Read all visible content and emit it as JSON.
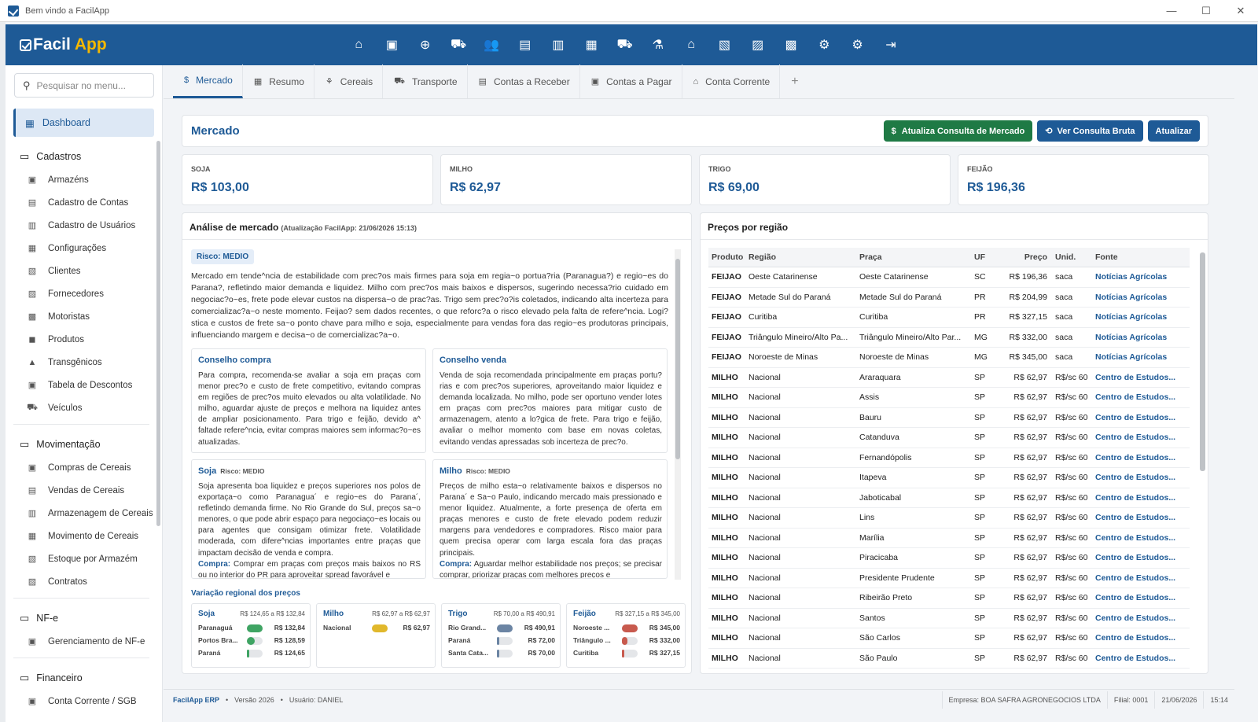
{
  "window": {
    "title": "Bem vindo a FacilApp",
    "controls": [
      "—",
      "☐",
      "✕"
    ]
  },
  "header": {
    "logo_a": "Facil",
    "logo_b": "App",
    "icons": [
      "home-icon",
      "wallet-icon",
      "cart-plus-icon",
      "cart-icon",
      "users-icon",
      "receipt-icon",
      "clipboard-icon",
      "id-badge-icon",
      "truck-icon",
      "flask-icon",
      "bank-icon",
      "money-check-icon",
      "cash-register-icon",
      "invoice-dollar-icon",
      "user-gear-icon",
      "settings-icon",
      "logout-icon"
    ],
    "glyphs": [
      "⌂",
      "▣",
      "⊕",
      "⛟",
      "👥",
      "▤",
      "▥",
      "▦",
      "⛟",
      "⚗",
      "⌂",
      "▧",
      "▨",
      "▩",
      "⚙",
      "⚙",
      "⇥"
    ]
  },
  "sidebar": {
    "search_placeholder": "Pesquisar no menu...",
    "dashboard": "Dashboard",
    "sections": [
      {
        "title": "Cadastros",
        "items": [
          "Armazéns",
          "Cadastro de Contas",
          "Cadastro de Usuários",
          "Configurações",
          "Clientes",
          "Fornecedores",
          "Motoristas",
          "Produtos",
          "Transgênicos",
          "Tabela de Descontos",
          "Veículos"
        ]
      },
      {
        "title": "Movimentação",
        "items": [
          "Compras de Cereais",
          "Vendas de Cereais",
          "Armazenagem de Cereais",
          "Movimento de Cereais",
          "Estoque por Armazém",
          "Contratos"
        ]
      },
      {
        "title": "NF-e",
        "items": [
          "Gerenciamento de NF-e"
        ]
      },
      {
        "title": "Financeiro",
        "items": [
          "Conta Corrente / SGB"
        ]
      }
    ]
  },
  "tabs": [
    {
      "label": "Mercado",
      "icon": "$"
    },
    {
      "label": "Resumo",
      "icon": "▦"
    },
    {
      "label": "Cereais",
      "icon": "⚘"
    },
    {
      "label": "Transporte",
      "icon": "⛟"
    },
    {
      "label": "Contas a Receber",
      "icon": "▤"
    },
    {
      "label": "Contas a Pagar",
      "icon": "▣"
    },
    {
      "label": "Conta Corrente",
      "icon": "⌂"
    }
  ],
  "tab_add": "+",
  "mercado": {
    "title": "Mercado",
    "btn_atualiza": "Atualiza Consulta de Mercado",
    "btn_bruta": "Ver Consulta Bruta",
    "btn_atualizar": "Atualizar"
  },
  "prices": [
    {
      "label": "SOJA",
      "value": "R$ 103,00"
    },
    {
      "label": "MILHO",
      "value": "R$ 62,97"
    },
    {
      "label": "TRIGO",
      "value": "R$ 69,00"
    },
    {
      "label": "FEIJÃO",
      "value": "R$ 196,36"
    }
  ],
  "analise": {
    "title": "Análise de mercado",
    "update": "(Atualização FacilApp: 21/06/2026 15:13)",
    "risk": "Risco: MEDIO",
    "text": "Mercado em tende^ncia de estabilidade com prec?os mais firmes para soja em regia~o portua?ria (Paranagua?) e regio~es do Parana?, refletindo maior demanda e liquidez. Milho com prec?os mais baixos e dispersos, sugerindo necessa?rio cuidado em negociac?o~es, frete pode elevar custos na dispersa~o de prac?as. Trigo sem prec?o?is coletados, indicando alta incerteza para comercializac?a~o neste momento. Feijao? sem dados recentes, o que reforc?a o risco elevado pela falta de refere^ncia. Logi?stica e custos de frete sa~o ponto chave para milho e soja, especialmente para vendas fora das regio~es produtoras principais, influenciando margem e decisa~o de comercializac?a~o.",
    "compra_title": "Conselho compra",
    "compra_text": "Para compra, recomenda-se avaliar a soja em prac̦as com menor prec?o e custo de frete competitivo, evitando compras em regiões de prec?os muito elevados ou alta volatilidade. No milho, aguardar ajuste de preços e melhora na liquidez antes de ampliar posicionamento. Para trigo e feijão, devido a^ faltade refere^ncia, evitar compras maiores sem informac?o~es atualizadas.",
    "venda_title": "Conselho venda",
    "venda_text": "Venda de soja recomendada principalmente em prac̦as portu?rias e com prec?os superiores, aproveitando maior liquidez e demanda localizada. No milho, pode ser oportuno vender lotes em prac̦as com prec?os maiores para mitigar custo de armazenagem, atento a lo?gica de frete. Para trigo e feijão, avaliar o melhor momento com base em novas coletas, evitando vendas apressadas sob incerteza de prec?o.",
    "soja_title": "Soja",
    "soja_risk": "Risco: MEDIO",
    "soja_text": "Soja apresenta boa liquidez e prec̦os superiores nos polos de exportac̦a~o como Paranagua´ e regio~es do Parana´, refletindo demanda firme. No Rio Grande do Sul, prec̦os sa~o menores, o que pode abrir espac̦o para negociac̦o~es locais ou para agentes que consigam otimizar frete. Volatilidade moderada, com difere^ncias importantes entre prac̦as que impactam decisão de venda e compra.",
    "soja_compra_label": "Compra:",
    "soja_compra": "Comprar em prac̦as com prec̦os mais baixos no RS ou no interior do PR para aproveitar spread favorável e",
    "milho_title": "Milho",
    "milho_risk": "Risco: MEDIO",
    "milho_text": "Prec̦os de milho esta~o relativamente baixos e dispersos no Parana´ e Sa~o Paulo, indicando mercado mais pressionado e menor liquidez. Atualmente, a forte presenc̦a de oferta em prac̦as menores e custo de frete elevado podem reduzir margens para vendedores e compradores. Risco maior para quem precisa operar com larga escala fora das prac̦as principais.",
    "milho_compra_label": "Compra:",
    "milho_compra": "Aguardar melhor estabilidade nos prec̦os; se precisar comprar, priorizar prac̦as com melhores prec̦os e",
    "var_title": "Variação regional dos preços",
    "variacao": [
      {
        "name": "Soja",
        "range": "R$ 124,65 a R$ 132,84",
        "rows": [
          {
            "n": "Paranaguá",
            "p": "R$ 132,84",
            "f": 1.0,
            "c": "#3fa463"
          },
          {
            "n": "Portos Bra...",
            "p": "R$ 128,59",
            "f": 0.5,
            "c": "#3fa463"
          },
          {
            "n": "Paraná",
            "p": "R$ 124,65",
            "f": 0.1,
            "c": "#3fa463"
          }
        ]
      },
      {
        "name": "Milho",
        "range": "R$ 62,97 a R$ 62,97",
        "rows": [
          {
            "n": "Nacional",
            "p": "R$ 62,97",
            "f": 1.0,
            "c": "#e1b82b"
          }
        ]
      },
      {
        "name": "Trigo",
        "range": "R$ 70,00 a R$ 490,91",
        "rows": [
          {
            "n": "Rio Grand...",
            "p": "R$ 490,91",
            "f": 1.0,
            "c": "#6b84a3"
          },
          {
            "n": "Paraná",
            "p": "R$ 72,00",
            "f": 0.1,
            "c": "#6b84a3"
          },
          {
            "n": "Santa Cata...",
            "p": "R$ 70,00",
            "f": 0.08,
            "c": "#6b84a3"
          }
        ]
      },
      {
        "name": "Feijão",
        "range": "R$ 327,15 a R$ 345,00",
        "rows": [
          {
            "n": "Noroeste ...",
            "p": "R$ 345,00",
            "f": 1.0,
            "c": "#c85a4e"
          },
          {
            "n": "Triângulo ...",
            "p": "R$ 332,00",
            "f": 0.35,
            "c": "#c85a4e"
          },
          {
            "n": "Curitiba",
            "p": "R$ 327,15",
            "f": 0.1,
            "c": "#c85a4e"
          }
        ]
      }
    ]
  },
  "precos": {
    "title": "Preços por região",
    "headers": [
      "Produto",
      "Região",
      "Praça",
      "UF",
      "Preço",
      "Unid.",
      "Fonte"
    ],
    "rows": [
      [
        "FEIJAO",
        "Oeste Catarinense",
        "Oeste Catarinense",
        "SC",
        "R$ 196,36",
        "saca",
        "Notícias Agrícolas"
      ],
      [
        "FEIJAO",
        "Metade Sul do Paraná",
        "Metade Sul do Paraná",
        "PR",
        "R$ 204,99",
        "saca",
        "Notícias Agrícolas"
      ],
      [
        "FEIJAO",
        "Curitiba",
        "Curitiba",
        "PR",
        "R$ 327,15",
        "saca",
        "Notícias Agrícolas"
      ],
      [
        "FEIJAO",
        "Triângulo Mineiro/Alto Pa...",
        "Triângulo Mineiro/Alto Par...",
        "MG",
        "R$ 332,00",
        "saca",
        "Notícias Agrícolas"
      ],
      [
        "FEIJAO",
        "Noroeste de Minas",
        "Noroeste de Minas",
        "MG",
        "R$ 345,00",
        "saca",
        "Notícias Agrícolas"
      ],
      [
        "MILHO",
        "Nacional",
        "Araraquara",
        "SP",
        "R$ 62,97",
        "R$/sc 60 ...",
        "Centro de Estudos..."
      ],
      [
        "MILHO",
        "Nacional",
        "Assis",
        "SP",
        "R$ 62,97",
        "R$/sc 60 ...",
        "Centro de Estudos..."
      ],
      [
        "MILHO",
        "Nacional",
        "Bauru",
        "SP",
        "R$ 62,97",
        "R$/sc 60 ...",
        "Centro de Estudos..."
      ],
      [
        "MILHO",
        "Nacional",
        "Catanduva",
        "SP",
        "R$ 62,97",
        "R$/sc 60 ...",
        "Centro de Estudos..."
      ],
      [
        "MILHO",
        "Nacional",
        "Fernandópolis",
        "SP",
        "R$ 62,97",
        "R$/sc 60 ...",
        "Centro de Estudos..."
      ],
      [
        "MILHO",
        "Nacional",
        "Itapeva",
        "SP",
        "R$ 62,97",
        "R$/sc 60 ...",
        "Centro de Estudos..."
      ],
      [
        "MILHO",
        "Nacional",
        "Jaboticabal",
        "SP",
        "R$ 62,97",
        "R$/sc 60 ...",
        "Centro de Estudos..."
      ],
      [
        "MILHO",
        "Nacional",
        "Lins",
        "SP",
        "R$ 62,97",
        "R$/sc 60 ...",
        "Centro de Estudos..."
      ],
      [
        "MILHO",
        "Nacional",
        "Marília",
        "SP",
        "R$ 62,97",
        "R$/sc 60 ...",
        "Centro de Estudos..."
      ],
      [
        "MILHO",
        "Nacional",
        "Piracicaba",
        "SP",
        "R$ 62,97",
        "R$/sc 60 ...",
        "Centro de Estudos..."
      ],
      [
        "MILHO",
        "Nacional",
        "Presidente Prudente",
        "SP",
        "R$ 62,97",
        "R$/sc 60 ...",
        "Centro de Estudos..."
      ],
      [
        "MILHO",
        "Nacional",
        "Ribeirão Preto",
        "SP",
        "R$ 62,97",
        "R$/sc 60 ...",
        "Centro de Estudos..."
      ],
      [
        "MILHO",
        "Nacional",
        "Santos",
        "SP",
        "R$ 62,97",
        "R$/sc 60 ...",
        "Centro de Estudos..."
      ],
      [
        "MILHO",
        "Nacional",
        "São Carlos",
        "SP",
        "R$ 62,97",
        "R$/sc 60 ...",
        "Centro de Estudos..."
      ],
      [
        "MILHO",
        "Nacional",
        "São Paulo",
        "SP",
        "R$ 62,97",
        "R$/sc 60 ...",
        "Centro de Estudos..."
      ]
    ]
  },
  "footer": {
    "erp": "FacilApp ERP",
    "sep": "•",
    "versao": "Versão 2026",
    "usuario": "Usuário: DANIEL",
    "empresa": "Empresa: BOA SAFRA AGRONEGOCIOS LTDA",
    "filial": "Filial: 0001",
    "data": "21/06/2026",
    "hora": "15:14"
  },
  "colors": {
    "primary": "#1e5a96",
    "success": "#1f7a45",
    "accent": "#f5b800"
  }
}
